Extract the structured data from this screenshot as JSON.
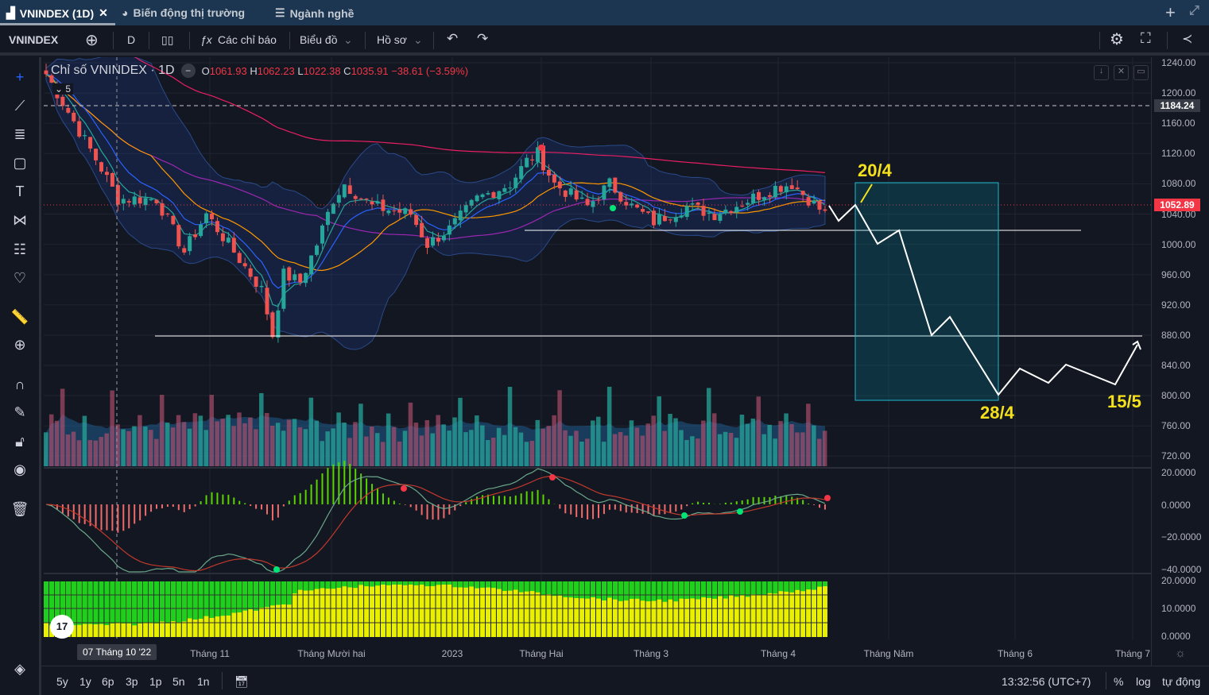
{
  "tabs": [
    {
      "label": "VNINDEX (1D)",
      "icon": "chart-icon",
      "active": true
    },
    {
      "label": "Biến động thị trường",
      "icon": "pie-icon"
    },
    {
      "label": "Ngành nghề",
      "icon": "list-icon"
    }
  ],
  "toolbar": {
    "symbol": "VNINDEX",
    "interval": "D",
    "indicators": "Các chỉ báo",
    "chart": "Biểu đồ",
    "profile": "Hồ sơ"
  },
  "legend": {
    "title": "Chỉ số VNINDEX · 1D",
    "o": "1061.93",
    "h": "1062.23",
    "l": "1022.38",
    "c": "1035.91",
    "change": "−38.61 (−3.59%)",
    "collapsed_count": "5"
  },
  "price_axis": [
    "1240.00",
    "1200.00",
    "1160.00",
    "1120.00",
    "1080.00",
    "1040.00",
    "1000.00",
    "960.00",
    "920.00",
    "880.00",
    "840.00",
    "800.00",
    "760.00",
    "720.00"
  ],
  "price_badges": {
    "dashed": "1184.24",
    "last": "1052.89"
  },
  "macd_axis": [
    "20.0000",
    "0.0000",
    "−20.0000",
    "−40.0000"
  ],
  "pane3_axis": [
    "20.0000",
    "10.0000",
    "0.0000"
  ],
  "time_axis": [
    "Tháng 11",
    "Tháng Mười hai",
    "2023",
    "Tháng Hai",
    "Tháng 3",
    "Tháng 4",
    "Tháng Năm",
    "Tháng 6",
    "Tháng 7"
  ],
  "crosshair_label": "07 Tháng 10 '22",
  "annotations": {
    "a1": "20/4",
    "a2": "28/4",
    "a3": "15/5"
  },
  "ranges": [
    "5y",
    "1y",
    "6p",
    "3p",
    "1p",
    "5n",
    "1n"
  ],
  "status": {
    "time": "13:32:56 (UTC+7)",
    "percent": "%",
    "log": "log",
    "auto": "tự động"
  },
  "colors": {
    "up": "#26a69a",
    "down": "#ef5350",
    "accent": "#2962ff",
    "annotation": "#f5e11b"
  },
  "price_keyframes": [
    [
      0,
      1225
    ],
    [
      6,
      1150
    ],
    [
      10,
      1100
    ],
    [
      13,
      1060
    ],
    [
      20,
      1060
    ],
    [
      25,
      990
    ],
    [
      29,
      1040
    ],
    [
      35,
      980
    ],
    [
      39,
      940
    ],
    [
      41,
      880
    ],
    [
      43,
      960
    ],
    [
      46,
      950
    ],
    [
      49,
      1000
    ],
    [
      52,
      1060
    ],
    [
      54,
      1080
    ],
    [
      59,
      1050
    ],
    [
      66,
      1040
    ],
    [
      69,
      1000
    ],
    [
      73,
      1020
    ],
    [
      78,
      1060
    ],
    [
      84,
      1080
    ],
    [
      87,
      1110
    ],
    [
      89,
      1120
    ],
    [
      92,
      1080
    ],
    [
      98,
      1050
    ],
    [
      102,
      1080
    ],
    [
      106,
      1050
    ],
    [
      110,
      1030
    ],
    [
      116,
      1050
    ],
    [
      121,
      1040
    ],
    [
      126,
      1055
    ],
    [
      132,
      1075
    ],
    [
      135,
      1080
    ],
    [
      141,
      1040
    ]
  ]
}
